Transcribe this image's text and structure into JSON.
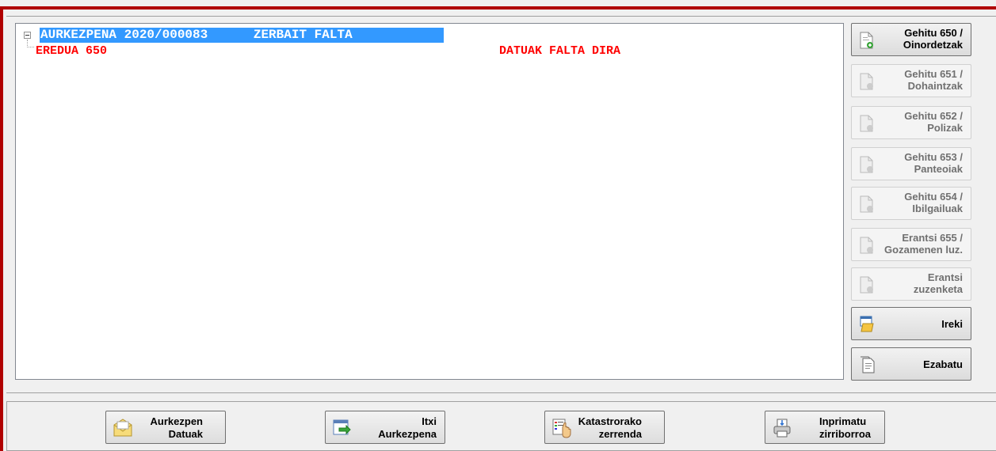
{
  "tree": {
    "root_label": "AURKEZPENA 2020/000083      ZERBAIT FALTA",
    "child_label": "EREDUA 650",
    "child_status": "DATUAK FALTA DIRA"
  },
  "side_buttons": [
    {
      "label": "Gehitu 650 /\nOinordetzak",
      "icon": "add-document-icon"
    },
    {
      "label": "Gehitu 651 /\nDohaintzak",
      "icon": "add-document-icon"
    },
    {
      "label": "Gehitu 652 /\nPolizak",
      "icon": "add-document-icon"
    },
    {
      "label": "Gehitu 653 /\nPanteoiak",
      "icon": "add-document-icon"
    },
    {
      "label": "Gehitu 654 /\nIbilgailuak",
      "icon": "add-document-icon"
    },
    {
      "label": "Erantsi 655 /\nGozamenen luz.",
      "icon": "add-document-icon"
    },
    {
      "label": "Erantsi\nzuzenketa",
      "icon": "add-document-icon"
    },
    {
      "label": "Ireki",
      "icon": "open-folder-window-icon"
    },
    {
      "label": "Ezabatu",
      "icon": "delete-document-icon"
    }
  ],
  "bottom_buttons": [
    {
      "label": "Aurkezpen\nDatuak",
      "icon": "envelope-icon"
    },
    {
      "label": "Itxi\nAurkezpena",
      "icon": "close-window-arrow-icon"
    },
    {
      "label": "Katastrorako\nzerrenda",
      "icon": "hand-list-icon"
    },
    {
      "label": "Inprimatu\nzirriborroa",
      "icon": "printer-icon"
    }
  ],
  "colors": {
    "frame": "#b00000",
    "selection": "#3399ff",
    "warning_text": "#ff0000"
  }
}
